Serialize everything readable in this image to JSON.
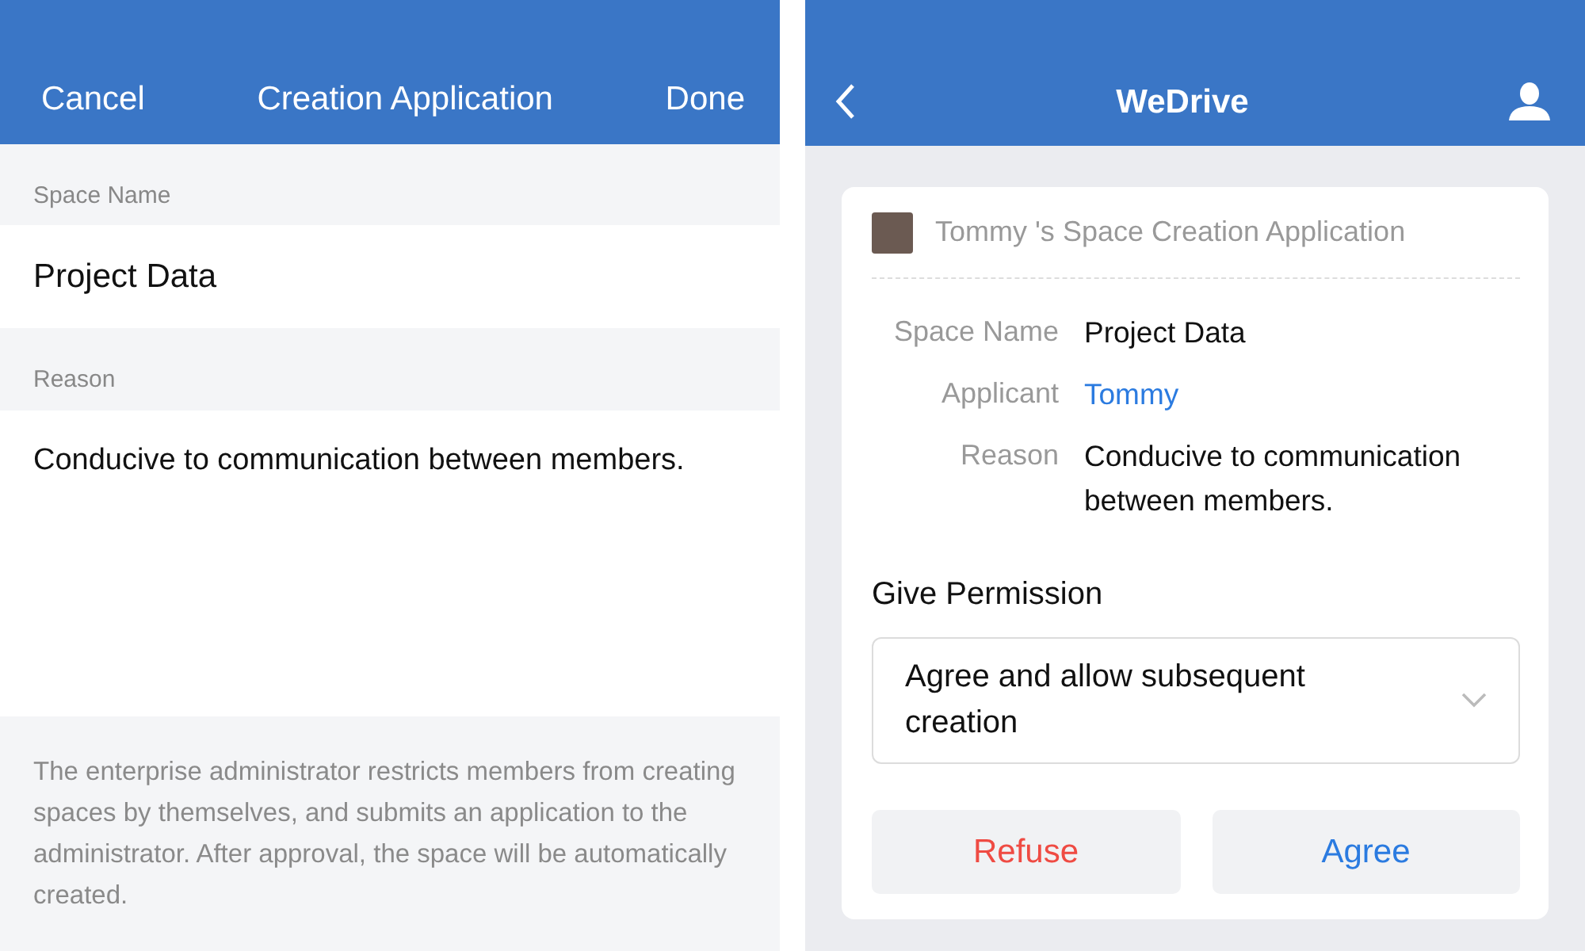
{
  "application_form": {
    "header": {
      "cancel": "Cancel",
      "title": "Creation Application",
      "done": "Done"
    },
    "fields": [
      {
        "label": "Space Name",
        "value": "Project Data",
        "kind": "single"
      },
      {
        "label": "Reason",
        "value": "Conducive to communication between members.",
        "kind": "multi"
      }
    ],
    "note": "The enterprise administrator restricts members from creating spaces by themselves, and submits an application to the administrator. After approval, the space will be automatically created."
  },
  "approval": {
    "header": {
      "title": "WeDrive"
    },
    "card_title": "Tommy 's Space Creation Application",
    "details": [
      {
        "label": "Space Name",
        "value": "Project Data",
        "kind": "text"
      },
      {
        "label": "Applicant",
        "value": "Tommy",
        "kind": "link"
      },
      {
        "label": "Reason",
        "value": "Conducive to communication between members.",
        "kind": "text"
      }
    ],
    "permission_label": "Give Permission",
    "permission_value": "Agree and allow subsequent creation",
    "buttons": [
      {
        "label": "Refuse",
        "kind": "danger"
      },
      {
        "label": "Agree",
        "kind": "primary"
      }
    ]
  }
}
